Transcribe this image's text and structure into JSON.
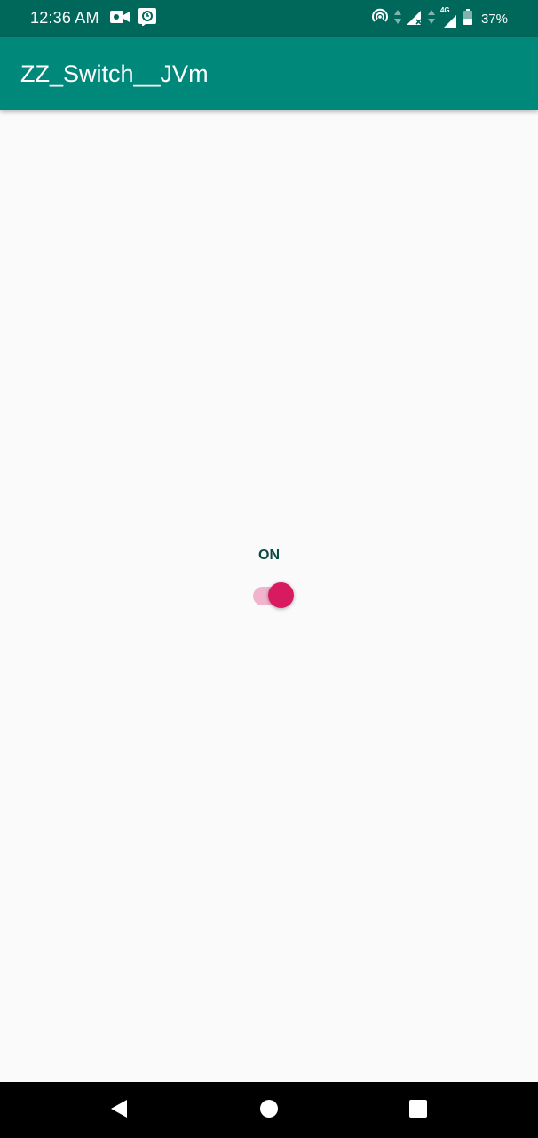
{
  "status_bar": {
    "time": "12:36 AM",
    "battery_percent": "37%",
    "network_type": "4G",
    "icons": [
      "video-camera-icon",
      "alarm-icon",
      "hotspot-icon",
      "data-arrows-icon",
      "signal-icon",
      "signal-4g-icon",
      "battery-icon"
    ]
  },
  "app_bar": {
    "title": "ZZ_Switch__JVm"
  },
  "content": {
    "switch_label": "ON",
    "switch_checked": true
  },
  "nav_bar": {
    "icons": [
      "back-icon",
      "home-icon",
      "recents-icon"
    ]
  },
  "colors": {
    "status_bar": "#00675b",
    "app_bar": "#00897b",
    "background": "#fafafa",
    "switch_thumb": "#d81b60",
    "switch_track": "#f2b4cc",
    "label_text": "#0b4a43",
    "nav_bar": "#000000"
  }
}
